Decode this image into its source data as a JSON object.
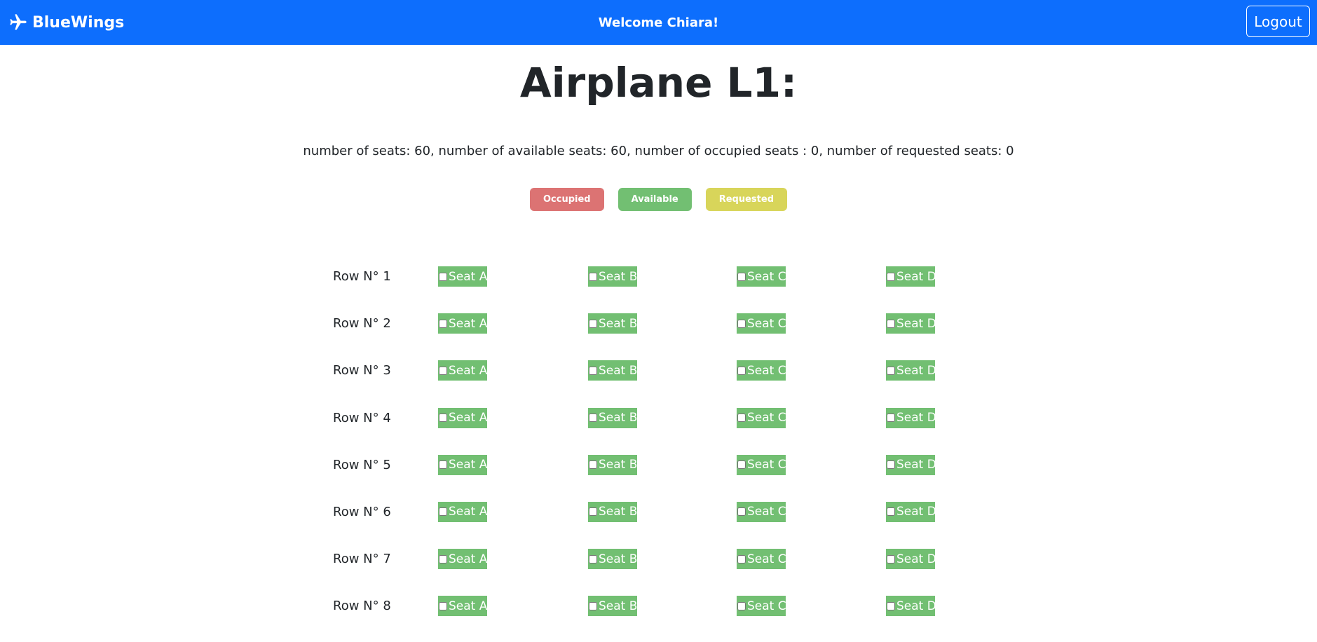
{
  "navbar": {
    "brand": "BlueWings",
    "brand_icon": "airplane-icon",
    "welcome": "Welcome Chiara!",
    "logout_label": "Logout",
    "color": "#0d6efd"
  },
  "page": {
    "title": "Airplane L1:",
    "stats": "number of seats: 60, number of available seats: 60, number of occupied seats : 0, number of requested seats: 0"
  },
  "legend": {
    "occupied": "Occupied",
    "available": "Available",
    "requested": "Requested",
    "colors": {
      "occupied": "#dc7373",
      "available": "#72bf72",
      "requested": "#d8d55a"
    }
  },
  "rows": [
    {
      "label": "Row N° 1",
      "seats": [
        "Seat A",
        "Seat B",
        "Seat C",
        "Seat D"
      ]
    },
    {
      "label": "Row N° 2",
      "seats": [
        "Seat A",
        "Seat B",
        "Seat C",
        "Seat D"
      ]
    },
    {
      "label": "Row N° 3",
      "seats": [
        "Seat A",
        "Seat B",
        "Seat C",
        "Seat D"
      ]
    },
    {
      "label": "Row N° 4",
      "seats": [
        "Seat A",
        "Seat B",
        "Seat C",
        "Seat D"
      ]
    },
    {
      "label": "Row N° 5",
      "seats": [
        "Seat A",
        "Seat B",
        "Seat C",
        "Seat D"
      ]
    },
    {
      "label": "Row N° 6",
      "seats": [
        "Seat A",
        "Seat B",
        "Seat C",
        "Seat D"
      ]
    },
    {
      "label": "Row N° 7",
      "seats": [
        "Seat A",
        "Seat B",
        "Seat C",
        "Seat D"
      ]
    },
    {
      "label": "Row N° 8",
      "seats": [
        "Seat A",
        "Seat B",
        "Seat C",
        "Seat D"
      ]
    }
  ]
}
